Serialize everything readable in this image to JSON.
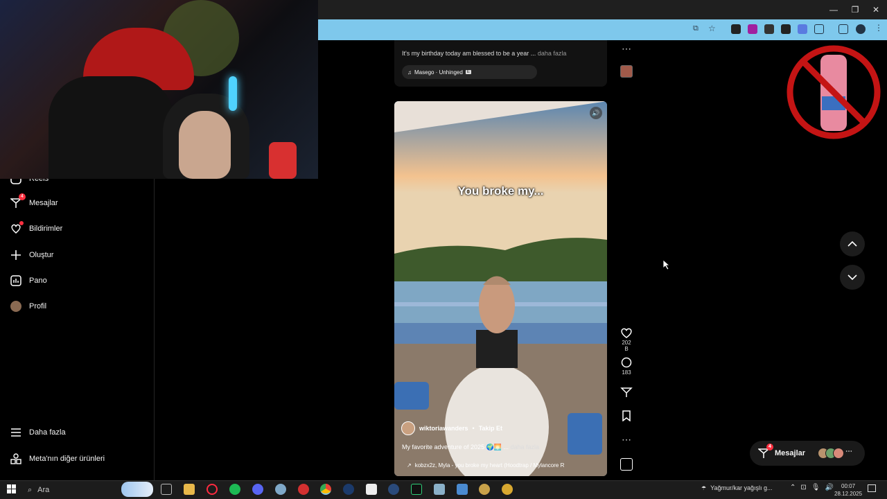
{
  "window": {
    "minimize": "—",
    "restore": "❐",
    "close": "✕"
  },
  "sidebar": {
    "items": [
      {
        "label": "Reels",
        "icon": "reels-icon"
      },
      {
        "label": "Mesajlar",
        "icon": "messenger-icon",
        "badge": "4"
      },
      {
        "label": "Bildirimler",
        "icon": "heart-icon"
      },
      {
        "label": "Oluştur",
        "icon": "plus-icon"
      },
      {
        "label": "Pano",
        "icon": "dashboard-icon"
      },
      {
        "label": "Profil",
        "icon": "profile-avatar"
      }
    ],
    "more": "Daha fazla",
    "meta": "Meta'nın diğer ürünleri"
  },
  "post_top": {
    "caption": "It's my birthday today am blessed to be a year ...",
    "more": "daha fazla",
    "audio": "Masego · Unhinged",
    "audio_badge": "E"
  },
  "reel": {
    "overlay_text": "You broke my...",
    "username": "wiktoriawanders",
    "separator": "•",
    "follow": "Takip Et",
    "caption": "My favorite adventure of 2025 🌍🌅 ...",
    "more": "daha fazla",
    "audio": "kobzx2z, Myla - you broke my heart (Hoodtrap / Mylancore R"
  },
  "actions": {
    "likes": "202 B",
    "comments": "183"
  },
  "messages_pill": {
    "label": "Mesajlar",
    "badge": "4"
  },
  "taskbar": {
    "search": "Ara",
    "weather": "Yağmur/kar yağışlı g...",
    "time": "00:07",
    "date": "28.12.2025"
  },
  "colors": {
    "accent": "#7ec8ec",
    "badge": "#ff3040",
    "background": "#000000"
  }
}
